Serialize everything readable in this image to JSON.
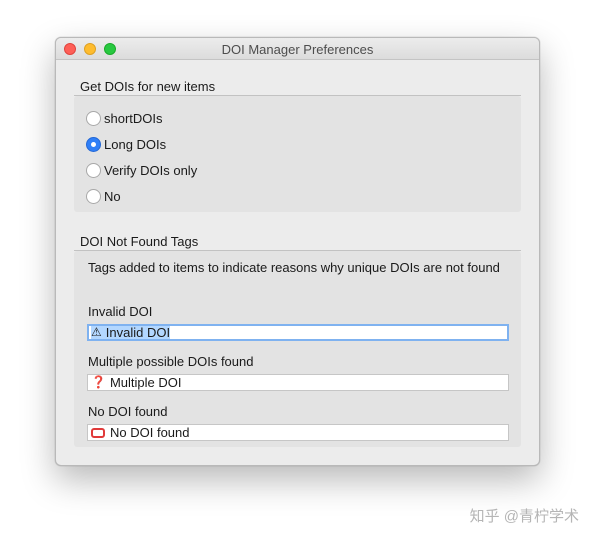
{
  "window": {
    "title": "DOI Manager Preferences"
  },
  "get_dois": {
    "title": "Get DOIs for new items",
    "options": [
      {
        "label": "shortDOIs",
        "selected": false
      },
      {
        "label": "Long DOIs",
        "selected": true
      },
      {
        "label": "Verify DOIs only",
        "selected": false
      },
      {
        "label": "No",
        "selected": false
      }
    ]
  },
  "not_found": {
    "title": "DOI Not Found Tags",
    "description": "Tags added to items to indicate reasons why unique DOIs are not found",
    "fields": [
      {
        "label": "Invalid DOI",
        "value": "Invalid DOI",
        "icon": "warning-icon",
        "icon_glyph": "⚠"
      },
      {
        "label": "Multiple possible DOIs found",
        "value": "Multiple DOI",
        "icon": "question-icon",
        "icon_glyph": "❓"
      },
      {
        "label": "No DOI found",
        "value": "No DOI found",
        "icon": "no-entry-icon",
        "icon_glyph": ""
      }
    ]
  },
  "watermark": "知乎 @青柠学术"
}
